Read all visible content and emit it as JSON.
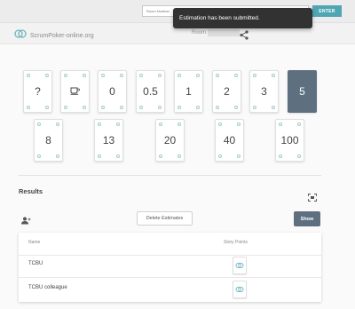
{
  "topbar": {
    "room_placeholder": "Room Number",
    "enter_label": "ENTER"
  },
  "header": {
    "logo_text": "ScrumPoker-online.org",
    "room_label": "Room"
  },
  "toast": {
    "message": "Estimation has been submitted."
  },
  "cards": {
    "row1": [
      "?",
      "coffee",
      "0",
      "0.5",
      "1",
      "2",
      "3",
      "5"
    ],
    "row2": [
      "8",
      "13",
      "20",
      "40",
      "100"
    ],
    "selected": "5"
  },
  "results": {
    "title": "Results",
    "delete_label": "Delete Estimates",
    "show_label": "Show",
    "columns": [
      "Name",
      "Story Points"
    ],
    "rows": [
      {
        "name": "TCBU",
        "vote_icon": "logo-icon"
      },
      {
        "name": "TCBU colleague",
        "vote_icon": "logo-icon"
      }
    ]
  },
  "colors": {
    "accent": "#4fa6b3",
    "selected_card": "#5e6f80",
    "toast_bg": "#323232"
  }
}
